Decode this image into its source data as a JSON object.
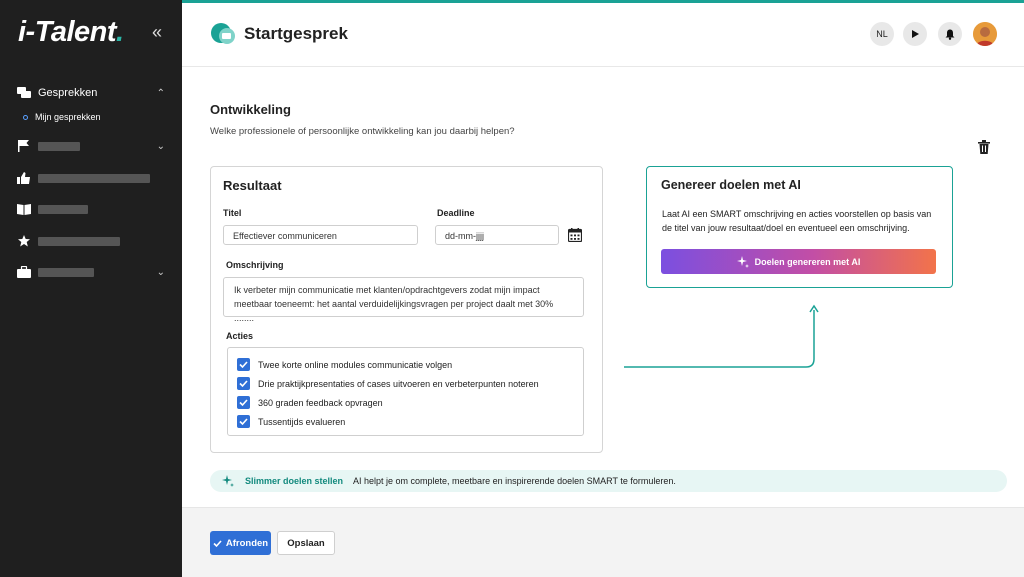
{
  "sidebar": {
    "logo": "i-Talent",
    "collapse_icon": "double-chevron-left-icon",
    "items": [
      {
        "label": "Gesprekken",
        "icon": "chat-icon"
      },
      {
        "label": "Mijn gesprekken",
        "icon": "bullet-icon"
      }
    ]
  },
  "header": {
    "title": "Startgesprek",
    "language": "NL"
  },
  "section": {
    "title": "Ontwikkeling",
    "question": "Welke professionele of persoonlijke ontwikkeling kan jou daarbij helpen?"
  },
  "result_card": {
    "title": "Resultaat",
    "titel_label": "Titel",
    "titel_value": "Effectiever communiceren",
    "deadline_label": "Deadline",
    "deadline_value": "dd-mm-jjjj",
    "omschrijving_label": "Omschrijving",
    "omschrijving_line1": "Ik verbeter mijn communicatie met klanten/opdrachtgevers zodat mijn impact",
    "omschrijving_line2": "meetbaar toeneemt: het aantal verduidelijkingsvragen per project daalt met 30% ........",
    "acties_label": "Acties",
    "acties": [
      "Twee korte online modules communicatie volgen",
      "Drie praktijkpresentaties of cases uitvoeren en verbeterpunten noteren",
      "360 graden feedback opvragen",
      "Tussentijds evalueren"
    ]
  },
  "ai_card": {
    "title": "Genereer doelen met AI",
    "text_line1": "Laat  AI een SMART omschrijving en acties voorstellen op  basis van",
    "text_line2": "de titel van jouw resultaat/doel en eventueel een omschrijving.",
    "button_label": "Doelen genereren met AI"
  },
  "banner": {
    "title": "Slimmer doelen stellen",
    "text": "AI helpt je om complete, meetbare en inspirerende doelen SMART te formuleren."
  },
  "footer": {
    "primary_label": "Afronden",
    "secondary_label": "Opslaan"
  },
  "colors": {
    "accent": "#1aa295",
    "primary": "#2f6fd6",
    "sidebar": "#1f1f1f"
  }
}
